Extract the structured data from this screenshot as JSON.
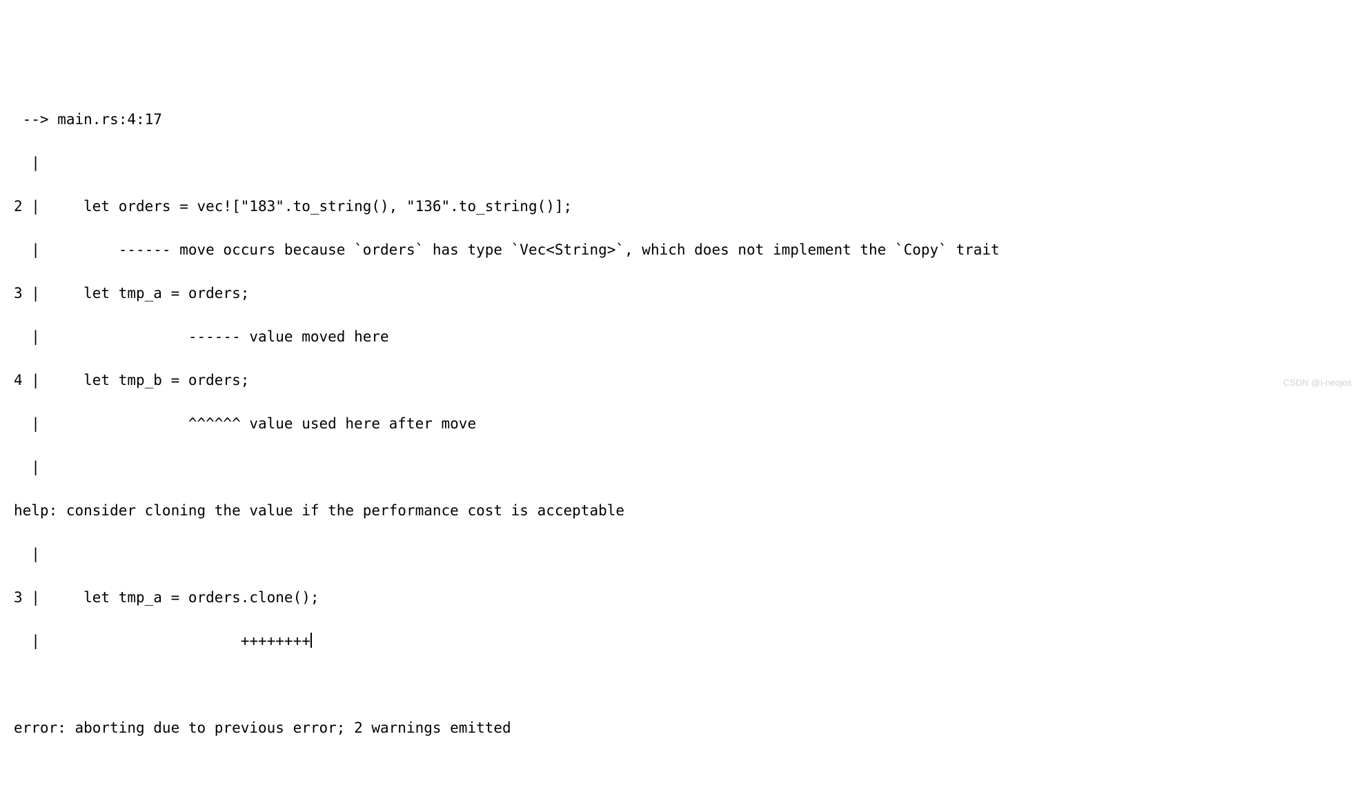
{
  "output": {
    "lines": [
      " --> main.rs:4:17",
      "  |",
      "2 |     let orders = vec![\"183\".to_string(), \"136\".to_string()];",
      "  |         ------ move occurs because `orders` has type `Vec<String>`, which does not implement the `Copy` trait",
      "3 |     let tmp_a = orders;",
      "  |                 ------ value moved here",
      "4 |     let tmp_b = orders;",
      "  |                 ^^^^^^ value used here after move",
      "  |",
      "help: consider cloning the value if the performance cost is acceptable",
      "  |",
      "3 |     let tmp_a = orders.clone();",
      "  |                       ++++++++",
      "",
      "error: aborting due to previous error; 2 warnings emitted"
    ],
    "cursor_line_index": 12
  },
  "watermark": "CSDN @i-neojos"
}
